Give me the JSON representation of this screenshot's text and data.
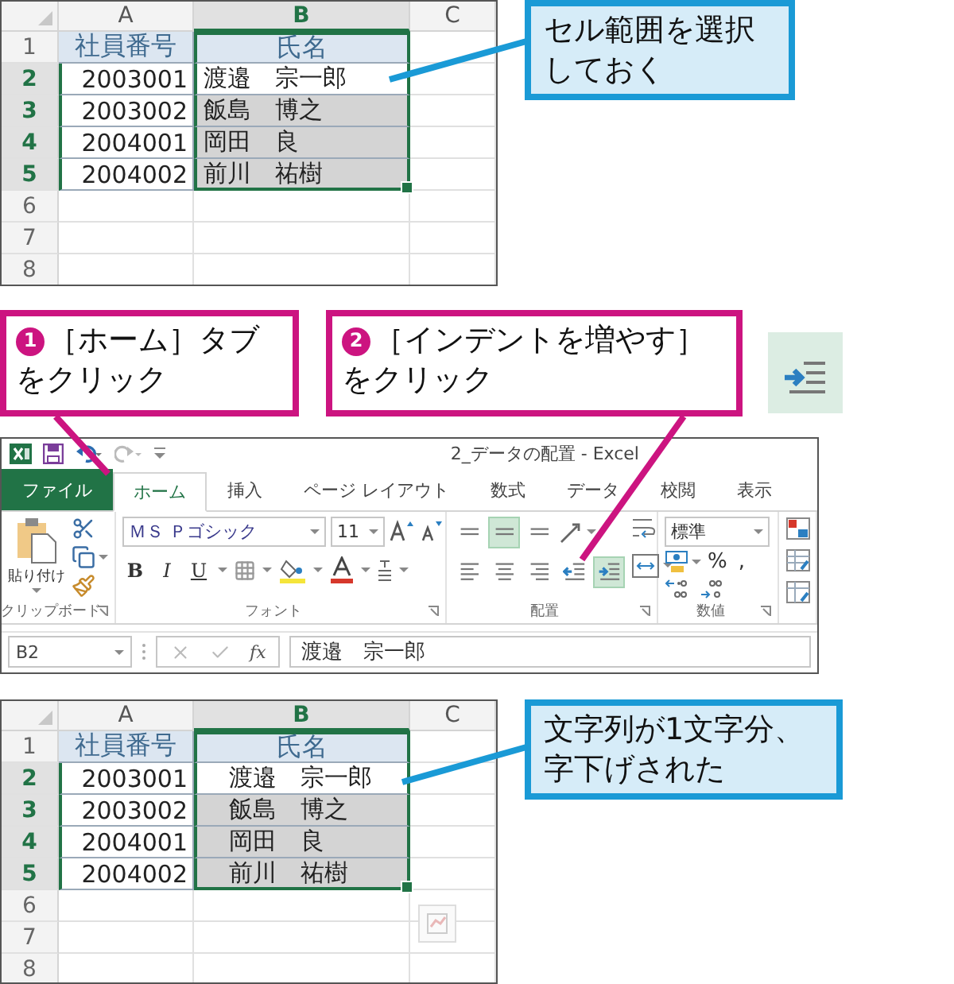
{
  "sheets": [
    {
      "columns": [
        {
          "label": "A",
          "selected": false
        },
        {
          "label": "B",
          "selected": true
        },
        {
          "label": "C",
          "selected": false
        }
      ],
      "rows": [
        {
          "number": "1",
          "kind": "header",
          "selected": false,
          "cells": [
            {
              "text": "社員番号"
            },
            {
              "text": "氏名"
            }
          ]
        },
        {
          "number": "2",
          "kind": "data",
          "selected": true,
          "cells": [
            {
              "text": "2003001"
            },
            {
              "text": "渡邉　宗一郎",
              "active": true
            }
          ]
        },
        {
          "number": "3",
          "kind": "data",
          "selected": true,
          "cells": [
            {
              "text": "2003002"
            },
            {
              "text": "飯島　博之",
              "active": false
            }
          ]
        },
        {
          "number": "4",
          "kind": "data",
          "selected": true,
          "cells": [
            {
              "text": "2004001"
            },
            {
              "text": "岡田　良",
              "active": false
            }
          ]
        },
        {
          "number": "5",
          "kind": "data",
          "selected": true,
          "cells": [
            {
              "text": "2004002"
            },
            {
              "text": "前川　祐樹",
              "active": false
            }
          ]
        },
        {
          "number": "6",
          "kind": "empty",
          "selected": false
        },
        {
          "number": "7",
          "kind": "empty",
          "selected": false
        },
        {
          "number": "8",
          "kind": "empty",
          "selected": false
        }
      ],
      "indented": false,
      "note": "セル範囲を選択しておく"
    },
    {
      "columns": [
        {
          "label": "A",
          "selected": false
        },
        {
          "label": "B",
          "selected": true
        },
        {
          "label": "C",
          "selected": false
        }
      ],
      "rows": [
        {
          "number": "1",
          "kind": "header",
          "selected": false,
          "cells": [
            {
              "text": "社員番号"
            },
            {
              "text": "氏名"
            }
          ]
        },
        {
          "number": "2",
          "kind": "data",
          "selected": true,
          "cells": [
            {
              "text": "2003001"
            },
            {
              "text": "渡邉　宗一郎",
              "active": true
            }
          ]
        },
        {
          "number": "3",
          "kind": "data",
          "selected": true,
          "cells": [
            {
              "text": "2003002"
            },
            {
              "text": "飯島　博之",
              "active": false
            }
          ]
        },
        {
          "number": "4",
          "kind": "data",
          "selected": true,
          "cells": [
            {
              "text": "2004001"
            },
            {
              "text": "岡田　良",
              "active": false
            }
          ]
        },
        {
          "number": "5",
          "kind": "data",
          "selected": true,
          "cells": [
            {
              "text": "2004002"
            },
            {
              "text": "前川　祐樹",
              "active": false
            }
          ]
        },
        {
          "number": "6",
          "kind": "empty",
          "selected": false
        },
        {
          "number": "7",
          "kind": "empty",
          "selected": false
        },
        {
          "number": "8",
          "kind": "empty",
          "selected": false
        }
      ],
      "indented": true,
      "quick_analysis": true,
      "note": "文字列が1文字分、字下げされた"
    }
  ],
  "steps": [
    {
      "number": "1",
      "text": "［ホーム］タブをクリック"
    },
    {
      "number": "2",
      "text": "［インデントを増やす］をクリック"
    }
  ],
  "excel": {
    "title": "2_データの配置 - Excel",
    "tabs": [
      {
        "label": "ファイル",
        "kind": "file",
        "selected": false
      },
      {
        "label": "ホーム",
        "kind": "tab",
        "selected": true
      },
      {
        "label": "挿入",
        "kind": "tab",
        "selected": false
      },
      {
        "label": "ページ レイアウト",
        "kind": "tab",
        "selected": false
      },
      {
        "label": "数式",
        "kind": "tab",
        "selected": false
      },
      {
        "label": "データ",
        "kind": "tab",
        "selected": false
      },
      {
        "label": "校閲",
        "kind": "tab",
        "selected": false
      },
      {
        "label": "表示",
        "kind": "tab",
        "selected": false
      }
    ],
    "clipboard": {
      "label": "クリップボード",
      "paste": "貼り付け"
    },
    "font": {
      "label": "フォント",
      "name": "ＭＳ Ｐゴシック",
      "size": "11",
      "styles": [
        "B",
        "I",
        "U"
      ]
    },
    "alignment": {
      "label": "配置",
      "buttons": [
        {
          "kind": "top",
          "selected": false
        },
        {
          "kind": "middle",
          "selected": true
        },
        {
          "kind": "bottom",
          "selected": false
        },
        {
          "kind": "left",
          "selected": false
        },
        {
          "kind": "center",
          "selected": false
        },
        {
          "kind": "right",
          "selected": false
        },
        {
          "kind": "indent_decrease",
          "selected": false
        },
        {
          "kind": "indent_increase",
          "selected": true
        }
      ]
    },
    "number": {
      "label": "数値",
      "format": "標準",
      "symbols": [
        "%",
        ","
      ]
    },
    "formula_bar": {
      "cell": "B2",
      "function": "fx",
      "value": "渡邉　宗一郎"
    }
  }
}
